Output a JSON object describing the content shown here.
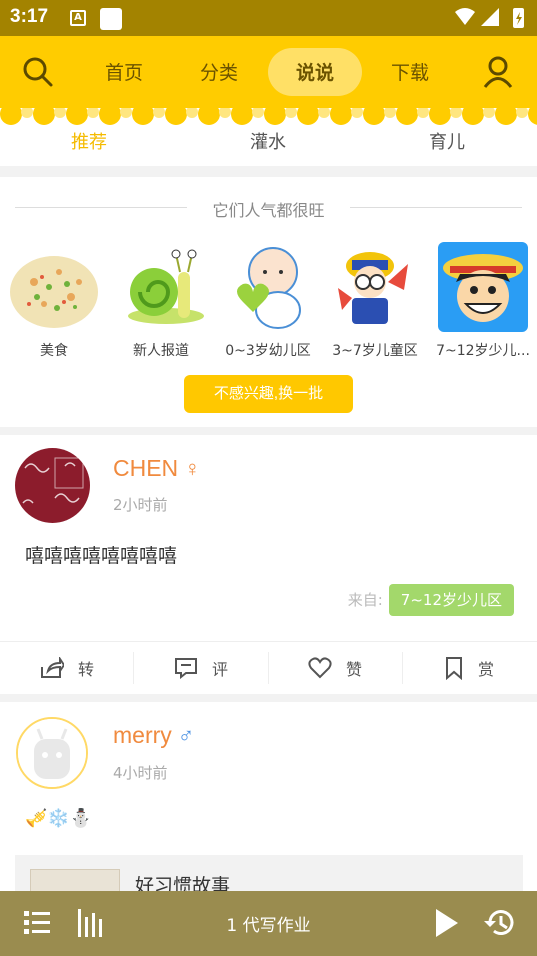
{
  "status_bar": {
    "time": "3:17",
    "notif_icon": "A"
  },
  "nav": {
    "tabs": [
      "首页",
      "分类",
      "说说",
      "下载"
    ],
    "active": "说说"
  },
  "subtabs": [
    "推荐",
    "灌水",
    "育儿"
  ],
  "popular": {
    "title": "它们人气都很旺",
    "items": [
      {
        "label": "美食",
        "icon": "fried-rice-image"
      },
      {
        "label": "新人报道",
        "icon": "snail-image"
      },
      {
        "label": "0~3岁幼儿区",
        "icon": "baby-image"
      },
      {
        "label": "3~7岁儿童区",
        "icon": "arale-image"
      },
      {
        "label": "7~12岁少儿...",
        "icon": "luffy-image"
      }
    ],
    "swap_button": "不感兴趣,换一批"
  },
  "posts": [
    {
      "username": "CHEN",
      "gender_symbol": "♀",
      "time": "2小时前",
      "content": "嘻嘻嘻嘻嘻嘻嘻嘻",
      "from_label": "来自:",
      "from_tag": "7~12岁少儿区",
      "actions": [
        "转",
        "评",
        "赞",
        "赏"
      ]
    },
    {
      "username": "merry",
      "gender_symbol": "♂",
      "time": "4小时前",
      "emoji": "🎺❄️⛄",
      "story_title": "好习惯故事"
    }
  ],
  "player": {
    "title": "1 代写作业"
  },
  "colors": {
    "primary": "#ffcc00",
    "statusbar": "#a38300",
    "player": "#9a8c4f",
    "username": "#f08a3e",
    "tag": "#a3d86b"
  }
}
